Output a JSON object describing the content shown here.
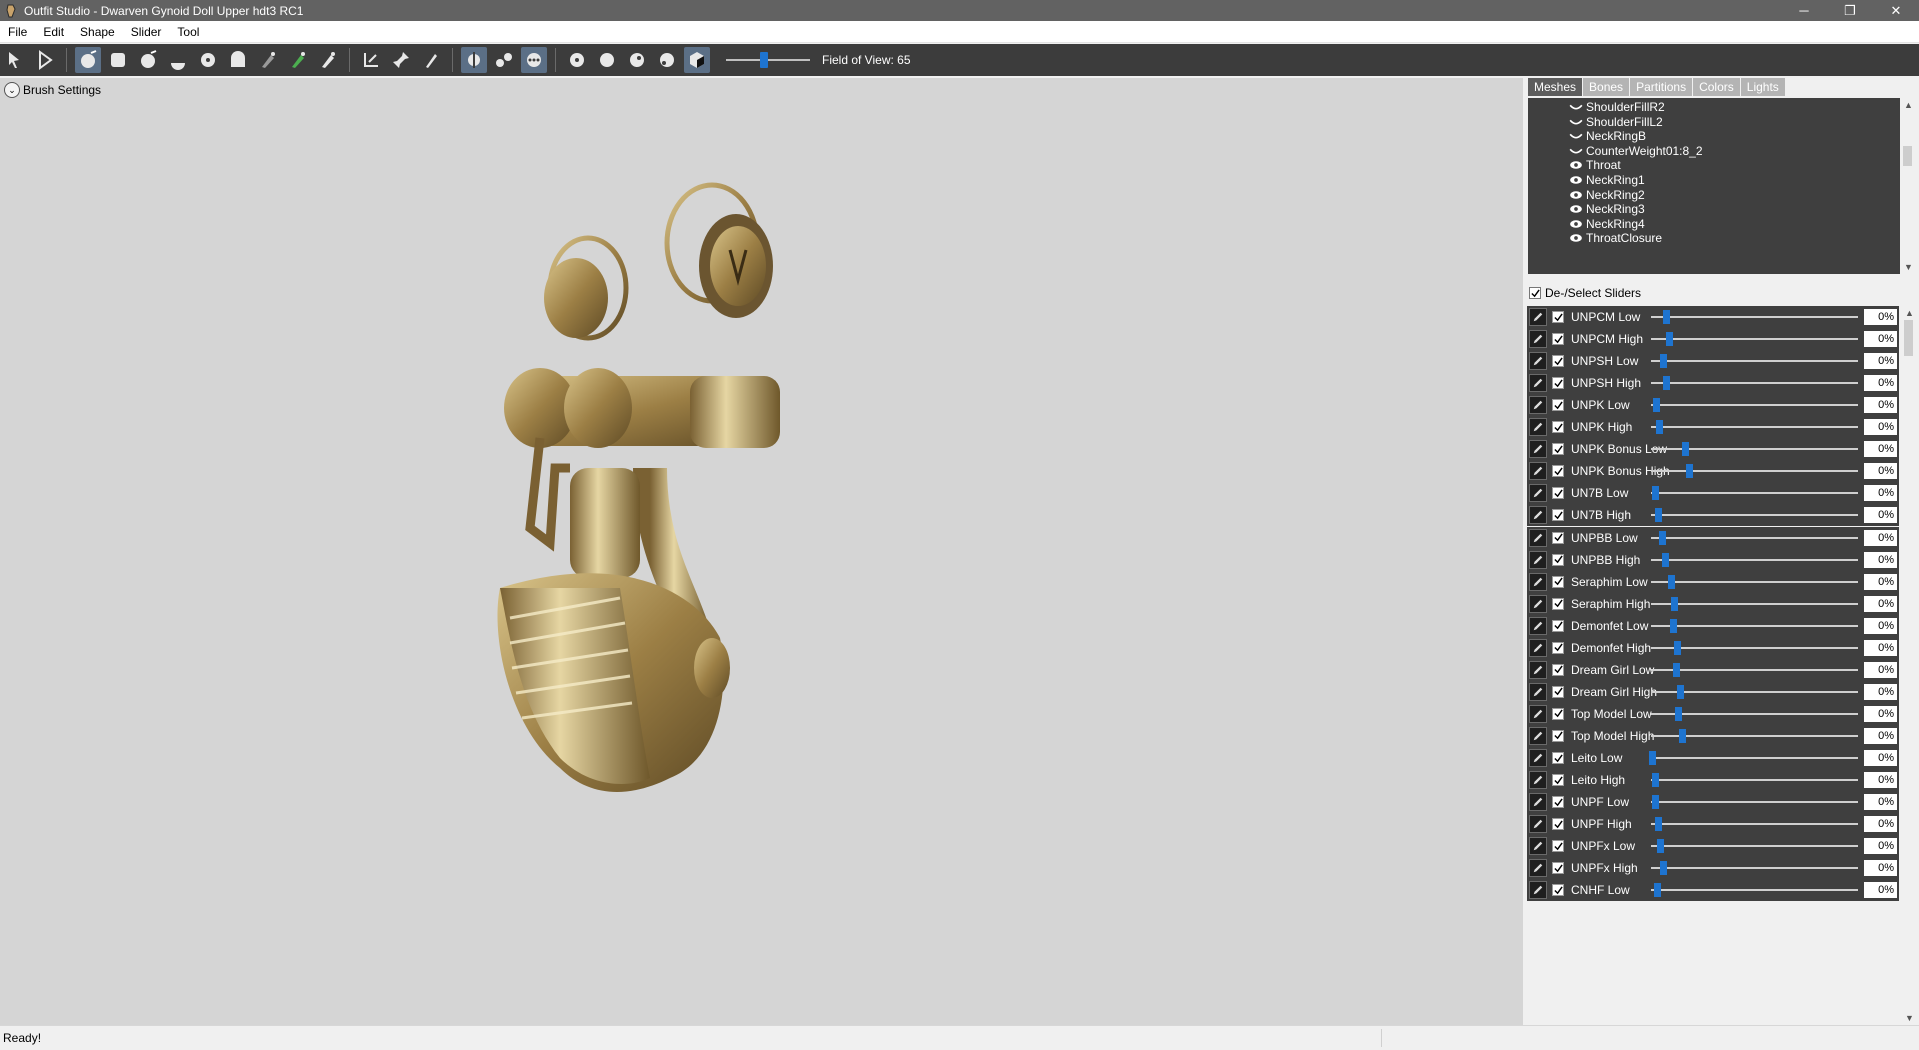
{
  "window": {
    "title": "Outfit Studio - Dwarven Gynoid Doll Upper hdt3 RC1",
    "minimize": "─",
    "restore": "❐",
    "close": "✕"
  },
  "menu": [
    "File",
    "Edit",
    "Shape",
    "Slider",
    "Tool"
  ],
  "toolbar": {
    "field_of_view_label": "Field of View: 65",
    "field_of_view_value": 65
  },
  "viewport": {
    "brush_settings_label": "Brush Settings",
    "brush_settings_glyph": "⌄"
  },
  "panel": {
    "tabs": [
      "Meshes",
      "Bones",
      "Partitions",
      "Colors",
      "Lights"
    ],
    "active_tab": "Meshes",
    "meshes": [
      {
        "name": "ShoulderFillR2",
        "icon": "hidden-icon"
      },
      {
        "name": "ShoulderFillL2",
        "icon": "hidden-icon"
      },
      {
        "name": "NeckRingB",
        "icon": "hidden-icon"
      },
      {
        "name": "CounterWeight01:8_2",
        "icon": "hidden-icon"
      },
      {
        "name": "Throat",
        "icon": "eye-icon"
      },
      {
        "name": "NeckRing1",
        "icon": "eye-icon"
      },
      {
        "name": "NeckRing2",
        "icon": "eye-icon"
      },
      {
        "name": "NeckRing3",
        "icon": "eye-icon"
      },
      {
        "name": "NeckRing4",
        "icon": "eye-icon"
      },
      {
        "name": "ThroatClosure",
        "icon": "eye-icon"
      }
    ],
    "deselect_label": "De-/Select Sliders",
    "sliders": [
      {
        "name": "UNPCM Low",
        "value": "0%"
      },
      {
        "name": "UNPCM High",
        "value": "0%"
      },
      {
        "name": "UNPSH Low",
        "value": "0%"
      },
      {
        "name": "UNPSH High",
        "value": "0%"
      },
      {
        "name": "UNPK Low",
        "value": "0%"
      },
      {
        "name": "UNPK High",
        "value": "0%"
      },
      {
        "name": "UNPK Bonus Low",
        "value": "0%"
      },
      {
        "name": "UNPK Bonus High",
        "value": "0%"
      },
      {
        "name": "UN7B Low",
        "value": "0%"
      },
      {
        "name": "UN7B High",
        "value": "0%"
      },
      {
        "name": "UNPBB Low",
        "value": "0%"
      },
      {
        "name": "UNPBB High",
        "value": "0%"
      },
      {
        "name": "Seraphim Low",
        "value": "0%"
      },
      {
        "name": "Seraphim High",
        "value": "0%"
      },
      {
        "name": "Demonfet Low",
        "value": "0%"
      },
      {
        "name": "Demonfet High",
        "value": "0%"
      },
      {
        "name": "Dream Girl Low",
        "value": "0%"
      },
      {
        "name": "Dream Girl High",
        "value": "0%"
      },
      {
        "name": "Top Model Low",
        "value": "0%"
      },
      {
        "name": "Top Model High",
        "value": "0%"
      },
      {
        "name": "Leito Low",
        "value": "0%"
      },
      {
        "name": "Leito High",
        "value": "0%"
      },
      {
        "name": "UNPF Low",
        "value": "0%"
      },
      {
        "name": "UNPF High",
        "value": "0%"
      },
      {
        "name": "UNPFx Low",
        "value": "0%"
      },
      {
        "name": "UNPFx High",
        "value": "0%"
      },
      {
        "name": "CNHF Low",
        "value": "0%"
      }
    ]
  },
  "status": {
    "text": "Ready!"
  },
  "colors": {
    "accent": "#1e74d0",
    "list_bg": "#3f3f3f",
    "toolbar_bg": "#3c3c3c",
    "viewport_bg": "#d5d5d5"
  }
}
